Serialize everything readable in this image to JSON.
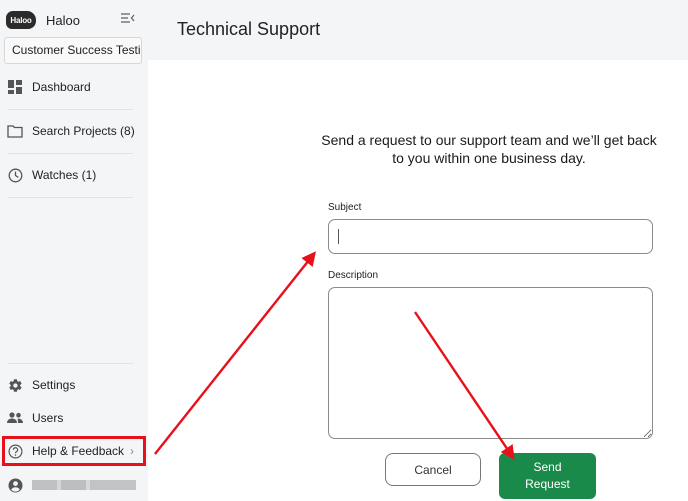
{
  "app": {
    "logo_text": "Haloo",
    "name": "Haloo",
    "workspace": "Customer Success Testing"
  },
  "sidebar": {
    "items": [
      {
        "label": "Dashboard",
        "icon": "dashboard-icon"
      },
      {
        "label": "Search Projects (8)",
        "icon": "folder-icon"
      },
      {
        "label": "Watches (1)",
        "icon": "clock-icon"
      }
    ],
    "bottom_items": [
      {
        "label": "Settings",
        "icon": "gear-icon"
      },
      {
        "label": "Users",
        "icon": "users-icon"
      },
      {
        "label": "Help & Feedback",
        "icon": "help-circle-icon",
        "chevron": "›"
      }
    ],
    "user": {
      "icon": "account-circle-icon",
      "name_blurred": true
    }
  },
  "header": {
    "title": "Technical Support"
  },
  "form": {
    "intro": "Send a request to our support team and we’ll get back to you within one business day.",
    "subject_label": "Subject",
    "subject_value": "",
    "description_label": "Description",
    "description_value": "",
    "cancel_label": "Cancel",
    "send_label": "Send Request"
  },
  "colors": {
    "annotation": "#e8101a",
    "primary_button": "#1a8a4a",
    "sidebar_bg": "#f4f5f7"
  },
  "annotations": [
    {
      "type": "highlight-box",
      "target": "Help & Feedback"
    },
    {
      "type": "arrow",
      "from": "Help & Feedback",
      "to": "Subject input"
    },
    {
      "type": "arrow",
      "from": "Description textarea",
      "to": "Send Request button"
    }
  ]
}
